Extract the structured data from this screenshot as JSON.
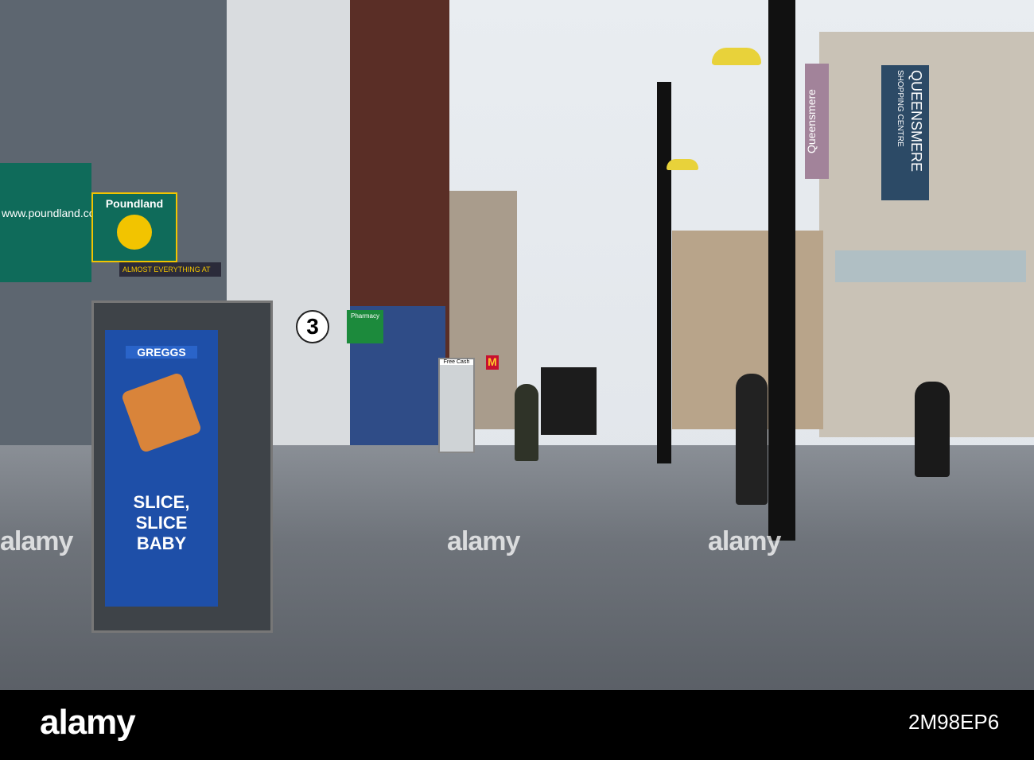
{
  "signs": {
    "poundland_url": "www.poundland.co.uk",
    "poundland": "Poundland",
    "poundland_tagline": "ALMOST EVERYTHING AT",
    "three": "3",
    "pharmacy": "Pharmacy",
    "free_cash": "Free Cash",
    "greggs": "GREGGS",
    "greggs_slogan": "SLICE, SLICE BABY",
    "queensmere_banner": "QUEENSMERE",
    "queensmere_sub": "SHOPPING CENTRE",
    "queensmere_vertical": "Queensmere",
    "mcdonalds": "M"
  },
  "watermark": "alamy",
  "footer": {
    "logo": "alamy",
    "image_id": "2M98EP6"
  },
  "colors": {
    "poundland_green": "#0f6b5a",
    "greggs_blue": "#1e4fa8",
    "banner_blue": "#2c4a66",
    "pole": "#111111"
  }
}
